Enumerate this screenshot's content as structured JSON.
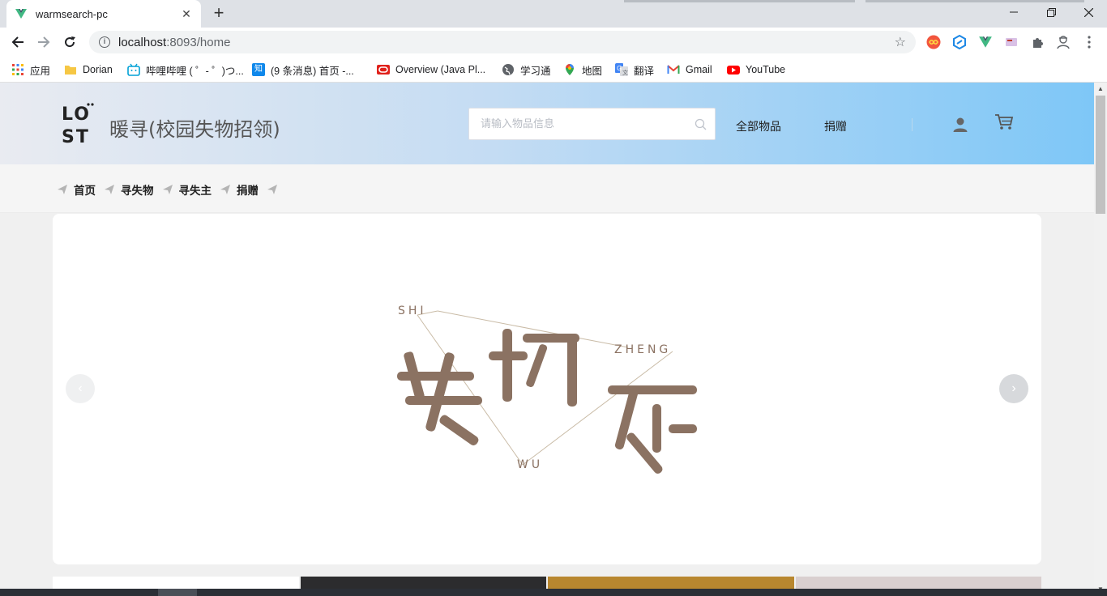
{
  "browser": {
    "tab_title": "warmsearch-pc",
    "tab_close": "✕",
    "new_tab": "+",
    "url_host": "localhost",
    "url_rest": ":8093/home"
  },
  "bookmarks": [
    {
      "label": "应用",
      "icon": "apps-grid-icon"
    },
    {
      "label": "Dorian",
      "icon": "folder-icon"
    },
    {
      "label": "哔哩哔哩 ( ゜- ゜)つ...",
      "icon": "bilibili-icon"
    },
    {
      "label": "(9 条消息) 首页 -...",
      "icon": "zhihu-icon"
    },
    {
      "label": "Overview (Java Pl...",
      "icon": "oracle-icon"
    },
    {
      "label": "学习通",
      "icon": "globe-icon"
    },
    {
      "label": "地图",
      "icon": "maps-pin-icon"
    },
    {
      "label": "翻译",
      "icon": "translate-icon"
    },
    {
      "label": "Gmail",
      "icon": "gmail-icon"
    },
    {
      "label": "YouTube",
      "icon": "youtube-icon"
    }
  ],
  "header": {
    "logo_text": "LOST",
    "site_title": "暖寻(校园失物招领)",
    "search_placeholder": "请输入物品信息",
    "nav_all_items": "全部物品",
    "nav_donate": "捐赠"
  },
  "subnav": {
    "items": [
      "首页",
      "寻失物",
      "寻失主",
      "捐赠"
    ]
  },
  "carousel": {
    "art_title": "失物招领",
    "pinyin_shi": "SHI",
    "pinyin_wu": "WU",
    "pinyin_zheng": "ZHENG",
    "prev": "‹",
    "next": "›"
  },
  "colors": {
    "accent_text": "#8b7262",
    "header_gradient_end": "#7ec7f7"
  }
}
